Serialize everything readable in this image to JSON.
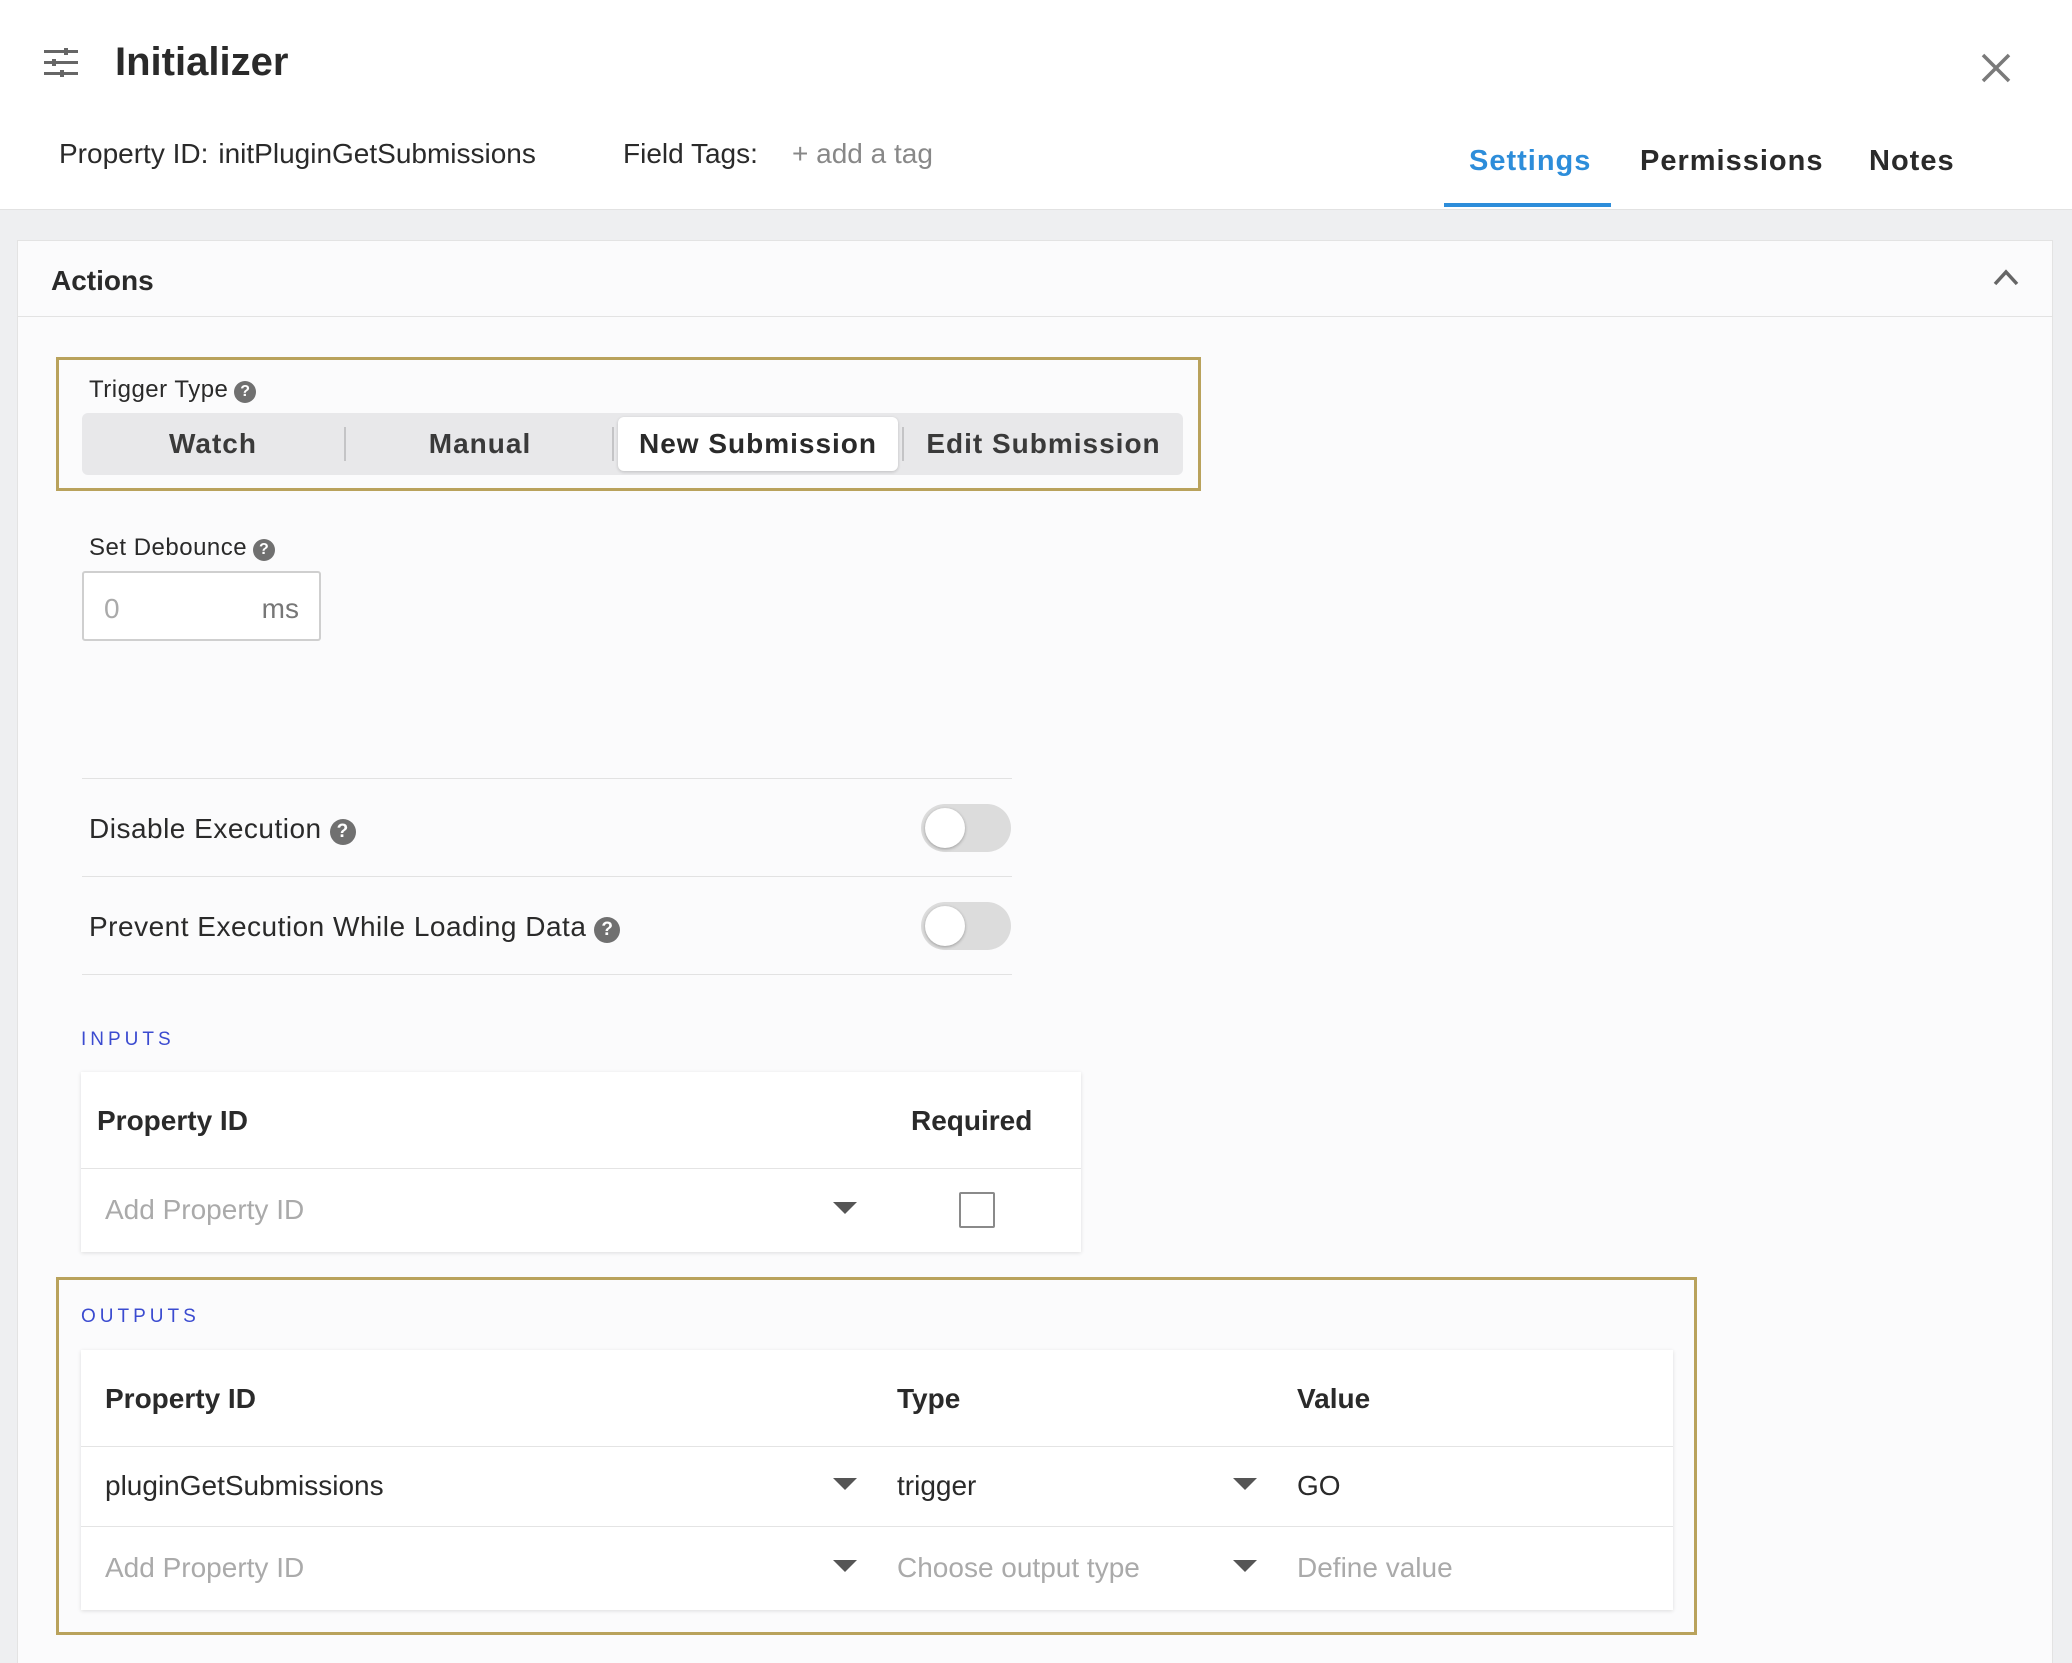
{
  "header": {
    "title": "Initializer",
    "property_id_label": "Property ID:",
    "property_id_value": "initPluginGetSubmissions",
    "field_tags_label": "Field Tags:",
    "add_tag": "+ add a tag",
    "tabs": [
      {
        "label": "Settings",
        "active": true
      },
      {
        "label": "Permissions",
        "active": false
      },
      {
        "label": "Notes",
        "active": false
      }
    ]
  },
  "actions": {
    "title": "Actions",
    "trigger_type": {
      "label": "Trigger Type",
      "options": [
        "Watch",
        "Manual",
        "New Submission",
        "Edit Submission"
      ],
      "selected": "New Submission"
    },
    "debounce": {
      "label": "Set Debounce",
      "value": "0",
      "unit": "ms"
    },
    "toggles": [
      {
        "label": "Disable Execution",
        "on": false
      },
      {
        "label": "Prevent Execution While Loading Data",
        "on": false
      }
    ],
    "inputs": {
      "caption": "INPUTS",
      "headers": [
        "Property ID",
        "Required"
      ],
      "placeholder": "Add Property ID",
      "required": false
    },
    "outputs": {
      "caption": "OUTPUTS",
      "headers": [
        "Property ID",
        "Type",
        "Value"
      ],
      "rows": [
        {
          "property_id": "pluginGetSubmissions",
          "type": "trigger",
          "value": "GO"
        }
      ],
      "placeholders": {
        "property_id": "Add Property ID",
        "type": "Choose output type",
        "value": "Define value"
      }
    }
  },
  "colors": {
    "accent": "#2d8dda",
    "highlight": "#b9a25c",
    "section_caption": "#3b4bd0"
  },
  "icons": [
    "menu-sliders-icon",
    "close-icon",
    "chevron-up-icon",
    "help-icon",
    "caret-down-icon"
  ]
}
